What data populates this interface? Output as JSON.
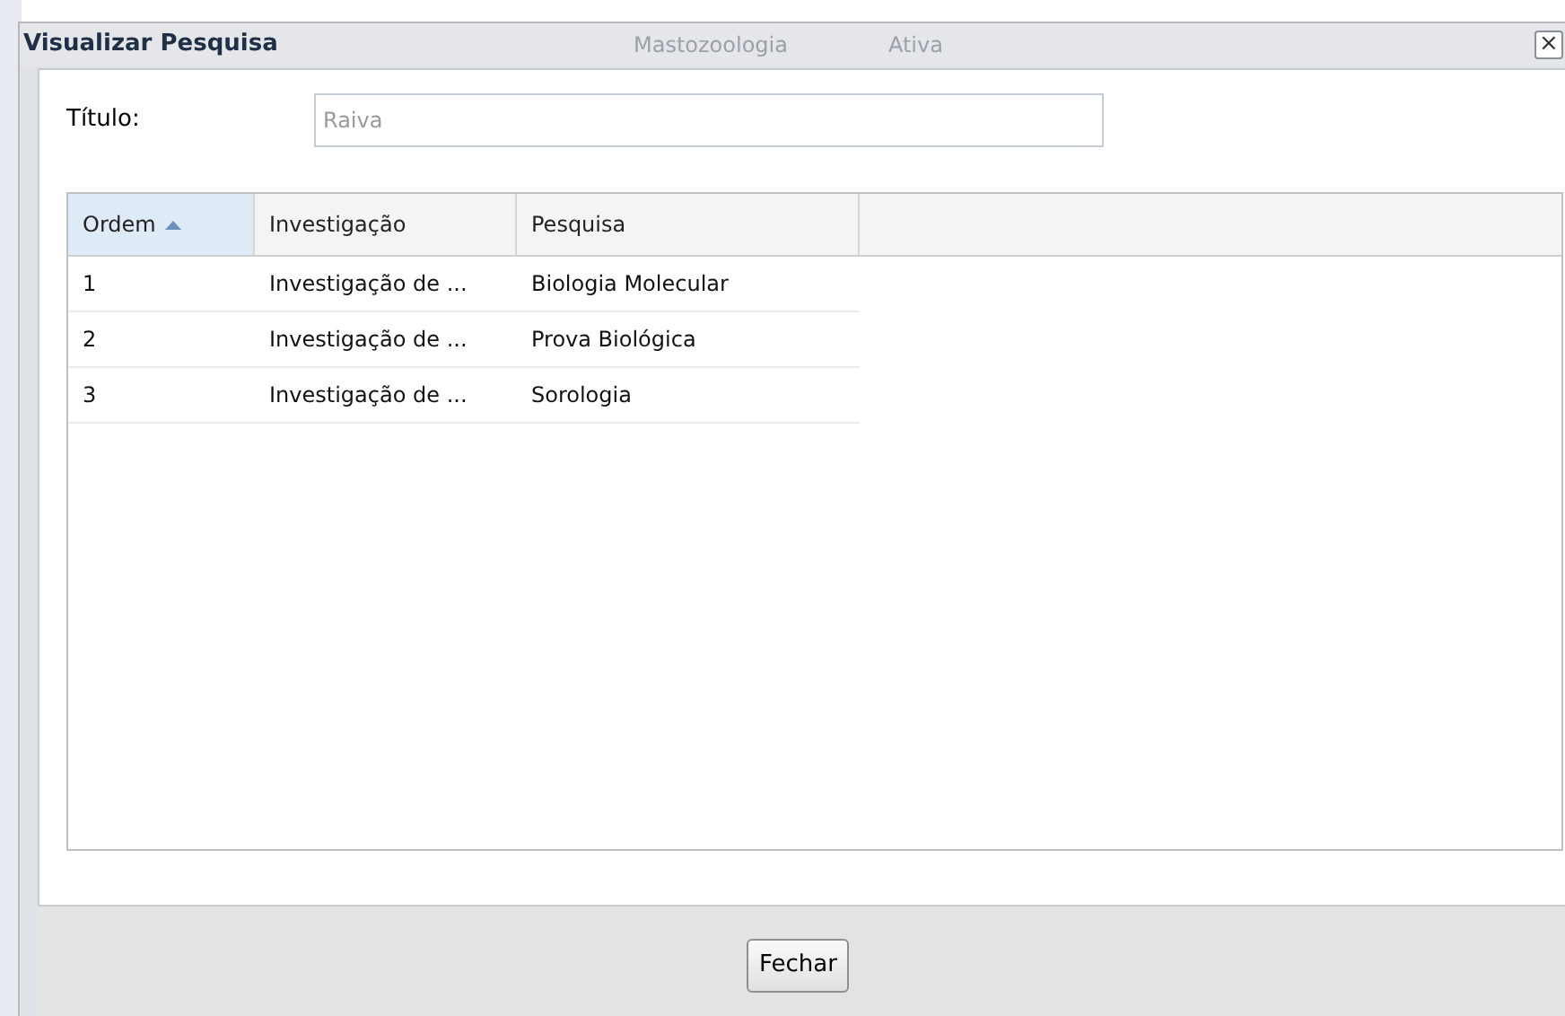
{
  "window": {
    "title": "Visualizar Pesquisa",
    "background_texts": [
      "Mastozoologia",
      "Ativa"
    ],
    "close": "×"
  },
  "form": {
    "label": "Título:",
    "value": "Raiva"
  },
  "table": {
    "columns": [
      {
        "label": "Ordem",
        "sorted": true
      },
      {
        "label": "Investigação",
        "sorted": false
      },
      {
        "label": "Pesquisa",
        "sorted": false
      }
    ],
    "rows": [
      [
        "1",
        "Investigação de ...",
        "Biologia Molecular"
      ],
      [
        "2",
        "Investigação de ...",
        "Prova Biológica"
      ],
      [
        "3",
        "Investigação de ...",
        "Sorologia"
      ]
    ]
  },
  "buttons": [
    "Fechar"
  ]
}
